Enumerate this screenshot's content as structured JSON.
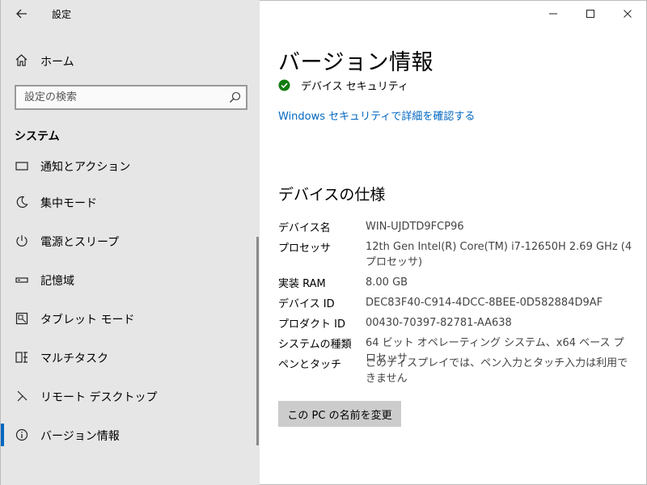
{
  "window": {
    "title": "設定"
  },
  "sidebar": {
    "home_label": "ホーム",
    "search_placeholder": "設定の検索",
    "section_title": "システム",
    "items": [
      {
        "label": "通知とアクション",
        "icon": "notification-icon"
      },
      {
        "label": "集中モード",
        "icon": "moon-icon"
      },
      {
        "label": "電源とスリープ",
        "icon": "power-icon"
      },
      {
        "label": "記憶域",
        "icon": "storage-icon"
      },
      {
        "label": "タブレット モード",
        "icon": "tablet-icon"
      },
      {
        "label": "マルチタスク",
        "icon": "multitask-icon"
      },
      {
        "label": "リモート デスクトップ",
        "icon": "remote-desktop-icon"
      },
      {
        "label": "バージョン情報",
        "icon": "info-icon",
        "active": true
      }
    ]
  },
  "main": {
    "title": "バージョン情報",
    "security_status": "デバイス セキュリティ",
    "security_link": "Windows セキュリティで詳細を確認する",
    "spec_title": "デバイスの仕様",
    "specs": [
      {
        "key": "デバイス名",
        "value": "WIN-UJDTD9FCP96"
      },
      {
        "key": "プロセッサ",
        "value": "12th Gen Intel(R) Core(TM) i7-12650H   2.69 GHz  (4 プロセッサ)"
      },
      {
        "key": "実装 RAM",
        "value": "8.00 GB"
      },
      {
        "key": "デバイス ID",
        "value": "DEC83F40-C914-4DCC-8BEE-0D582884D9AF"
      },
      {
        "key": "プロダクト ID",
        "value": "00430-70397-82781-AA638"
      },
      {
        "key": "システムの種類",
        "value": "64 ビット オペレーティング システム、x64 ベース プロセッサ"
      },
      {
        "key": "ペンとタッチ",
        "value": "このディスプレイでは、ペン入力とタッチ入力は利用できません"
      }
    ],
    "rename_button": "この PC の名前を変更"
  },
  "colors": {
    "accent": "#0067c0",
    "success": "#107c10",
    "sidebar_bg": "#e6e6e6"
  }
}
